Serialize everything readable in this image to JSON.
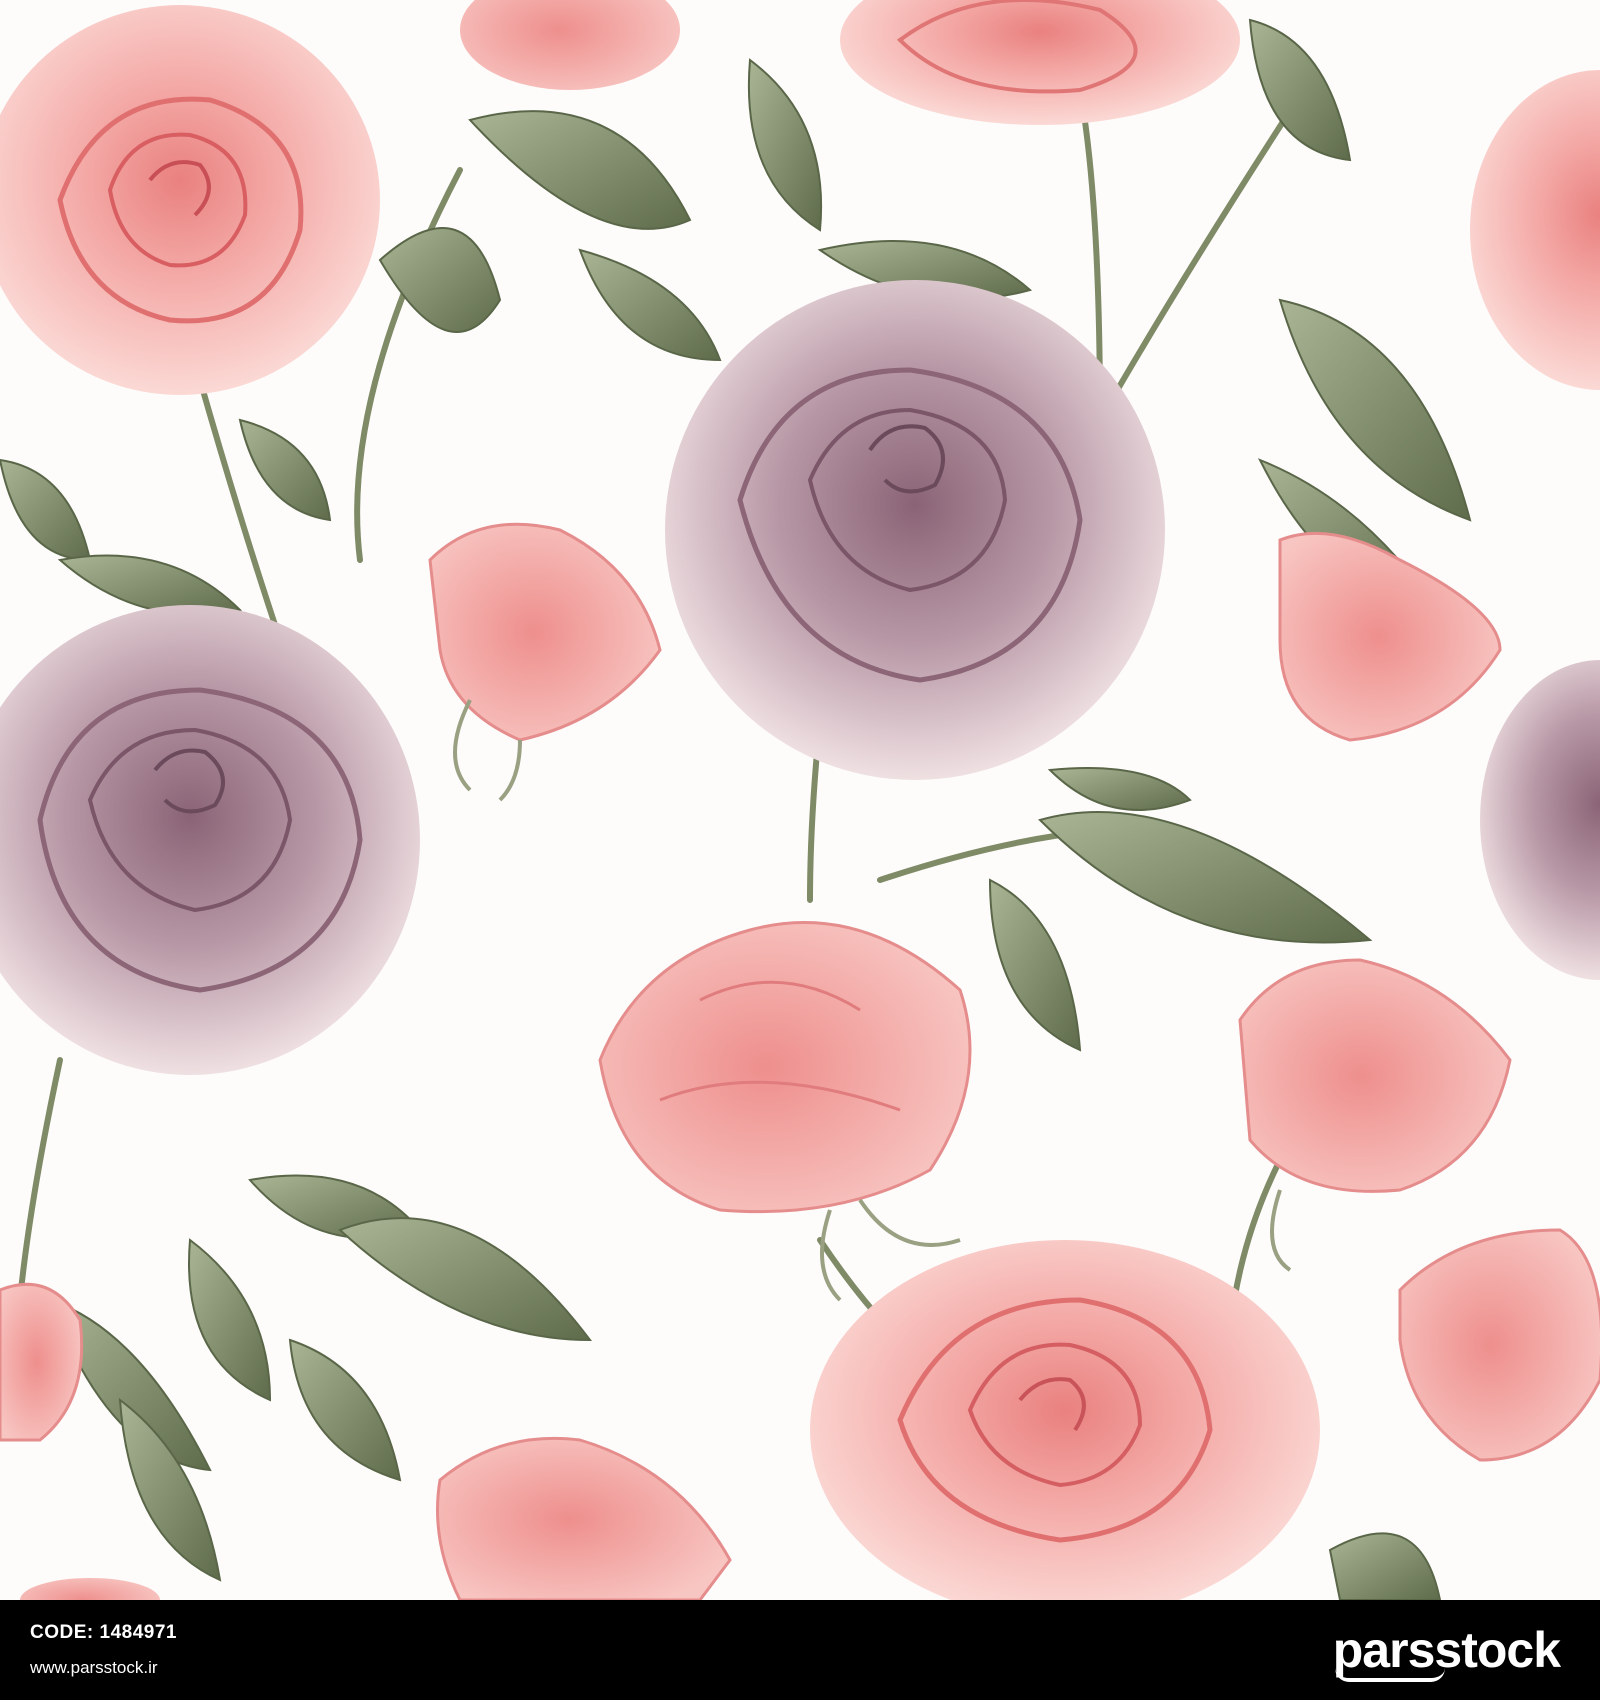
{
  "image": {
    "subject": "seamless watercolor pattern of pink and mauve roses with green leaves",
    "colors": {
      "background": "#fdfcfb",
      "pink_rose": "#f2a6a4",
      "pink_rose_dark": "#e07a7a",
      "mauve_rose": "#cfb0b9",
      "mauve_rose_dark": "#8e6a79",
      "leaf": "#8e9a78",
      "leaf_dark": "#5f6c4c",
      "footer_bg": "#000000",
      "footer_text": "#ffffff"
    },
    "watermark": "parsstock"
  },
  "footer": {
    "code_text": "CODE: 1484971",
    "site_text": "www.parsstock.ir",
    "brand_text": "parsstock"
  }
}
